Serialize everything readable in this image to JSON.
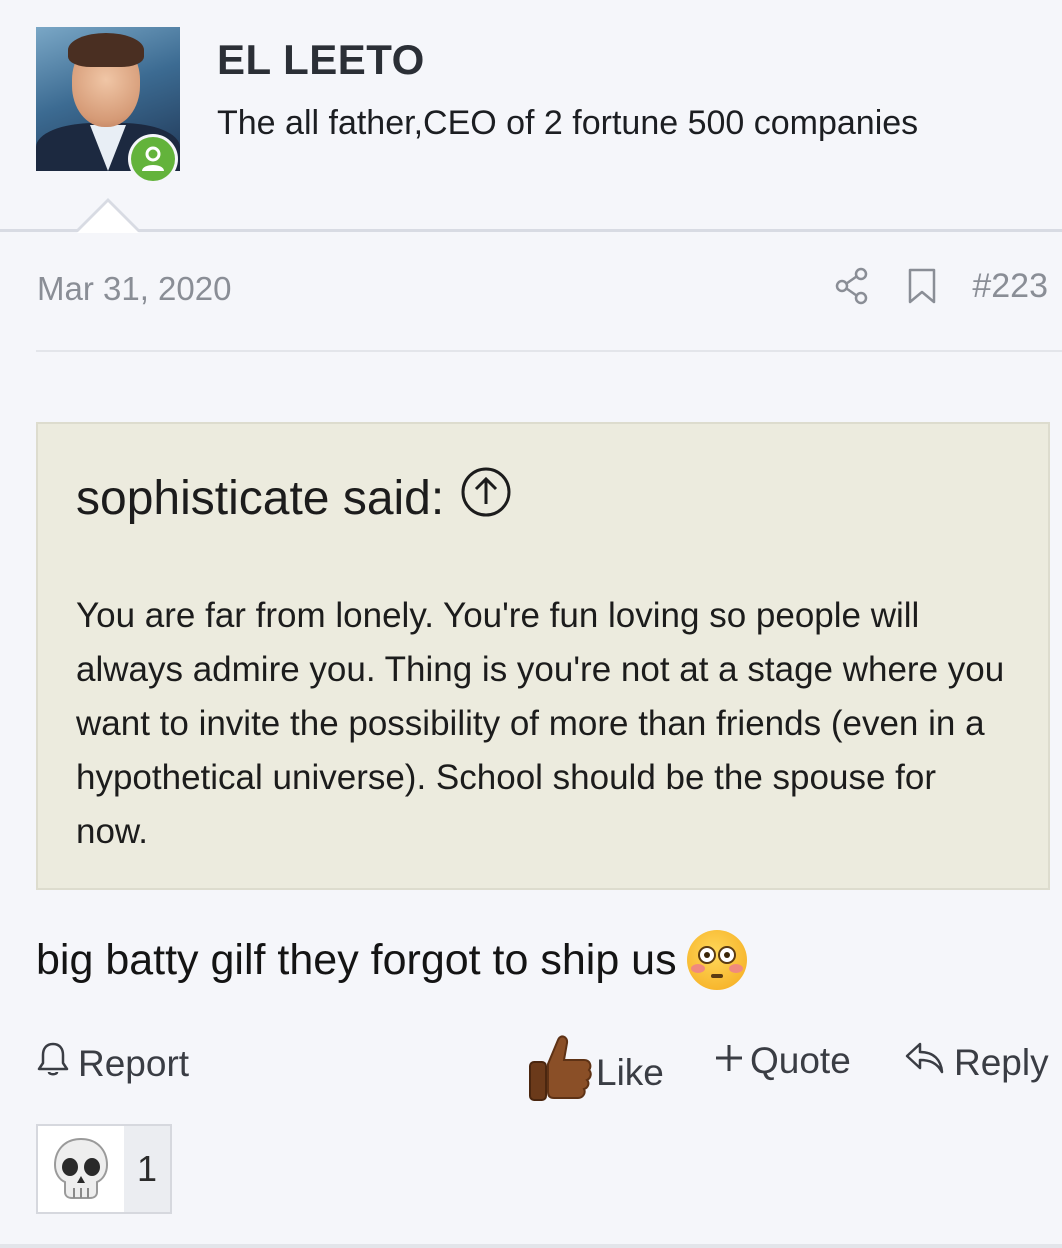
{
  "user": {
    "name": "EL LEETO",
    "title": "The all father,CEO of 2 fortune 500 companies",
    "status": "online"
  },
  "post": {
    "date": "Mar 31, 2020",
    "number": "#223",
    "icons": [
      "share-icon",
      "bookmark-icon"
    ],
    "quote": {
      "attribution": "sophisticate said:",
      "text": "You are far from lonely. You're fun loving so people will always admire you. Thing is you're not at a stage where you want to invite the possibility of more than friends (even in a hypothetical universe). School should be the spouse for now."
    },
    "message": "big batty gilf they forgot to ship us",
    "message_emoji": "flushed-face"
  },
  "actions": {
    "report": "Report",
    "like": "Like",
    "quote": "Quote",
    "reply": "Reply"
  },
  "reactions": [
    {
      "emoji": "skull",
      "count": "1"
    }
  ],
  "colors": {
    "background": "#f5f6fa",
    "quote_background": "#ecebde",
    "online_green": "#63b33b",
    "muted_text": "#8a8e96"
  }
}
